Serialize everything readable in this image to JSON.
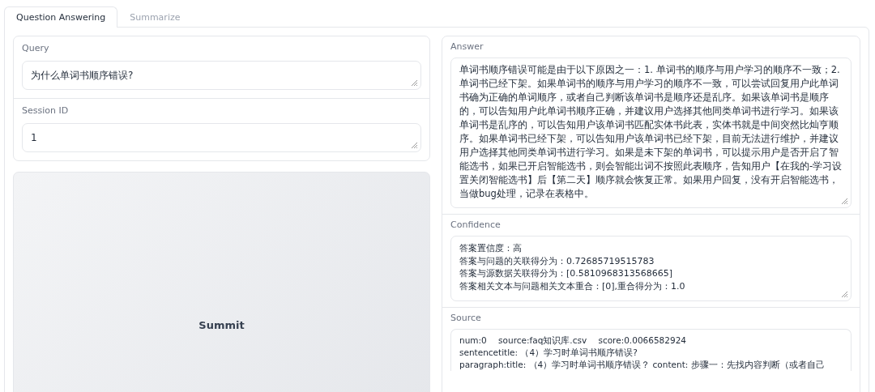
{
  "tabs": [
    {
      "label": "Question Answering",
      "selected": true
    },
    {
      "label": "Summarize",
      "selected": false
    }
  ],
  "query": {
    "label": "Query",
    "value": "为什么单词书顺序错误?"
  },
  "session": {
    "label": "Session ID",
    "value": "1"
  },
  "submit_button": {
    "label": "Summit"
  },
  "answer": {
    "label": "Answer",
    "value": "单词书顺序错误可能是由于以下原因之一：1. 单词书的顺序与用户学习的顺序不一致；2. 单词书已经下架。如果单词书的顺序与用户学习的顺序不一致，可以尝试回复用户此单词书确为正确的单词顺序，或者自己判断该单词书是顺序还是乱序。如果该单词书是顺序的，可以告知用户此单词书顺序正确，并建议用户选择其他同类单词书进行学习。如果该单词书是乱序的，可以告知用户该单词书匹配实体书此表，实体书就是中间突然比灿亨顺序。如果单词书已经下架，可以告知用户该单词书已经下架，目前无法进行维护，并建议用户选择其他同类单词书进行学习。如果是未下架的单词书，可以提示用户是否开启了智能选书，如果已开启智能选书，则会智能出词不按照此表顺序，告知用户【在我的-学习设置关闭智能选书】后【第二天】顺序就会恢复正常。如果用户回复，没有开启智能选书，当做bug处理，记录在表格中。"
  },
  "confidence": {
    "label": "Confidence",
    "lines": [
      "答案置信度：高",
      "答案与问题的关联得分为：0.72685719515783",
      "答案与源数据关联得分为：[0.5810968313568665]",
      "答案相关文本与问题相关文本重合：[0],重合得分为：1.0"
    ]
  },
  "source": {
    "label": "Source",
    "lines": [
      "num:0　 source:faq知识库.csv　 score:0.0066582924",
      "sentencetitle: （4）学习时单词书顺序错误?",
      "paragraph:title: （4）学习时单词书顺序错误？ content: 步骤一：先找内容判断（或者自己"
    ]
  }
}
